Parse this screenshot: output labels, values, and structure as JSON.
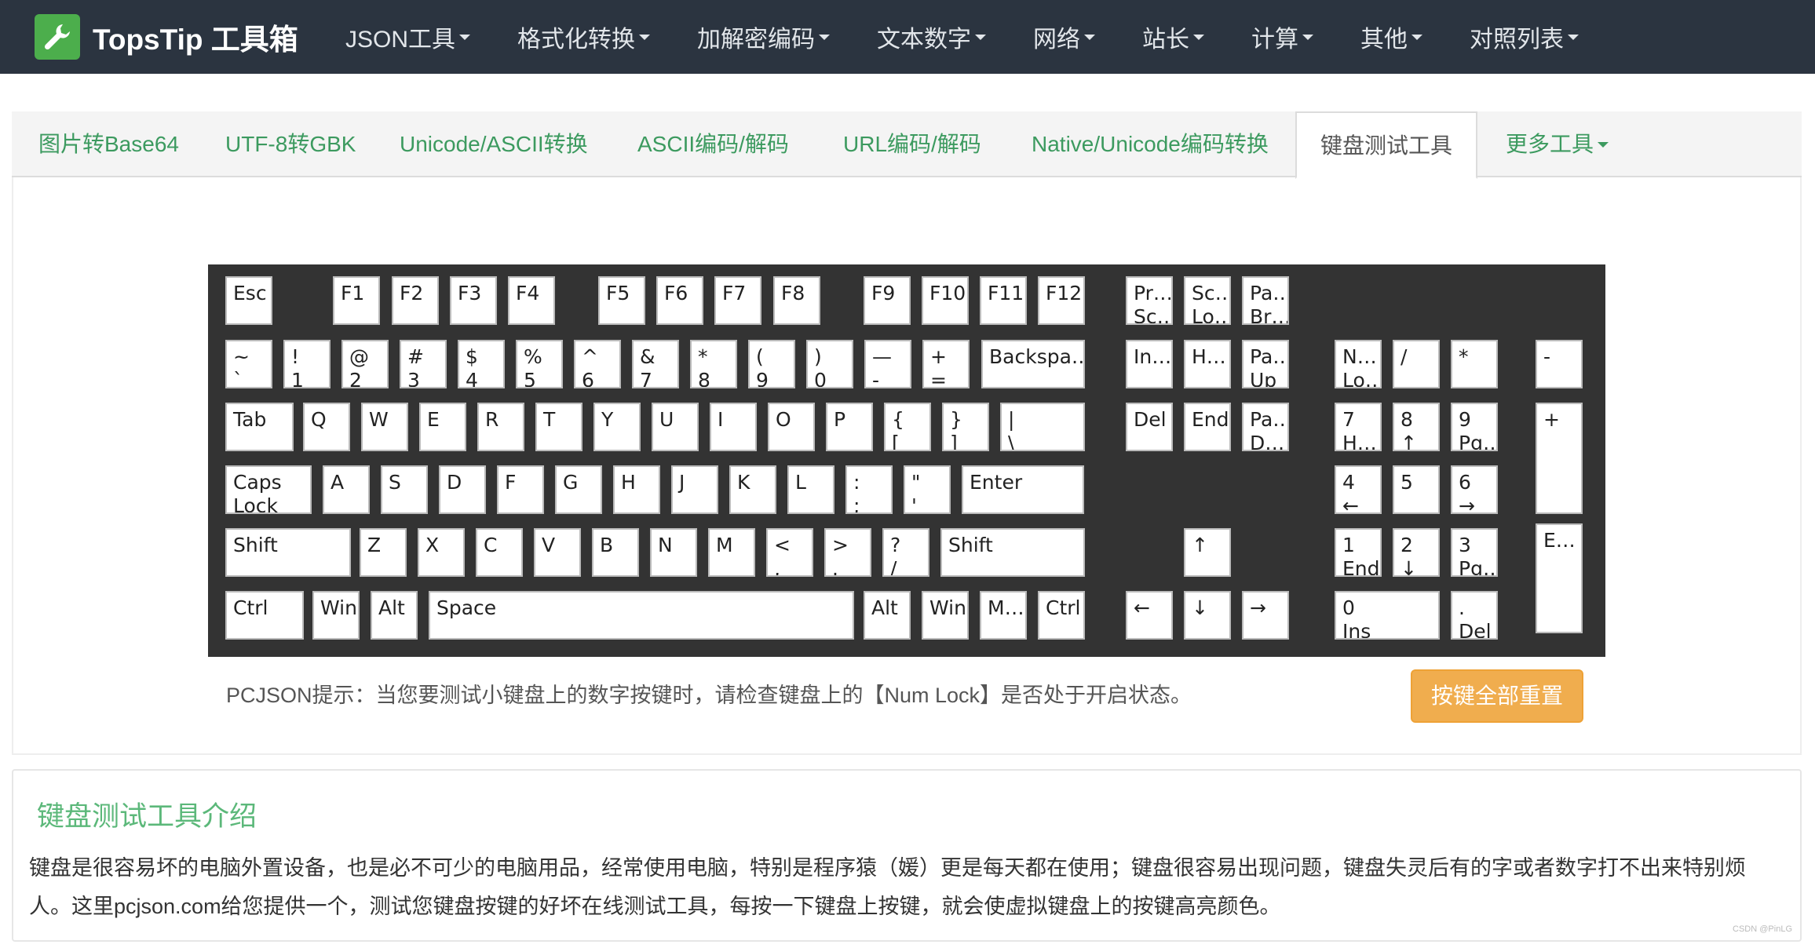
{
  "navbar": {
    "brand": "TopsTip 工具箱",
    "brand_icon": "wrench-icon",
    "items": [
      "JSON工具",
      "格式化转换",
      "加解密编码",
      "文本数字",
      "网络",
      "站长",
      "计算",
      "其他",
      "对照列表"
    ]
  },
  "tabs": [
    "图片转Base64",
    "UTF-8转GBK",
    "Unicode/ASCII转换",
    "ASCII编码/解码",
    "URL编码/解码",
    "Native/Unicode编码转换",
    "键盘测试工具",
    "更多工具"
  ],
  "active_tab": "键盘测试工具",
  "keyboard": {
    "keys": [
      "Esc",
      "F1",
      "F2",
      "F3",
      "F4",
      "F5",
      "F6",
      "F7",
      "F8",
      "F9",
      "F10",
      "F11",
      "F12",
      "Pr…\nSc…",
      "Sc…\nLo…",
      "Pa…\nBr…",
      "~\n`",
      "!\n1",
      "@\n2",
      "#\n3",
      "$\n4",
      "%\n5",
      "^\n6",
      "&\n7",
      "*\n8",
      "(\n9",
      ")\n0",
      "—\n-",
      "+\n=",
      "Backspa…",
      "In…",
      "H…",
      "Pa…\nUp",
      "N…\nLo…",
      "/",
      "*",
      "-",
      "Tab",
      "Q",
      "W",
      "E",
      "R",
      "T",
      "Y",
      "U",
      "I",
      "O",
      "P",
      "{\n[",
      "}\n]",
      "|\n\\",
      "Del",
      "End",
      "Pa…\nD…",
      "7\nH…",
      "8\n↑",
      "9\nPg…",
      "+",
      "Caps\nLock",
      "A",
      "S",
      "D",
      "F",
      "G",
      "H",
      "J",
      "K",
      "L",
      ":\n;",
      "\"\n'",
      "Enter",
      "4\n←",
      "5",
      "6\n→",
      "Shift",
      "Z",
      "X",
      "C",
      "V",
      "B",
      "N",
      "M",
      "<\n,",
      ">\n.",
      "?\n/",
      "Shift",
      "↑",
      "1\nEnd",
      "2\n↓",
      "3\nPg…",
      "E…",
      "Ctrl",
      "Win",
      "Alt",
      "Space",
      "Alt",
      "Win",
      "M…",
      "Ctrl",
      "←",
      "↓",
      "→",
      "0\nIns",
      ".\nDel"
    ]
  },
  "hint": "PCJSON提示：当您要测试小键盘上的数字按键时，请检查键盘上的【Num Lock】是否处于开启状态。",
  "reset_button": "按键全部重置",
  "intro": {
    "title": "键盘测试工具介绍",
    "body": "键盘是很容易坏的电脑外置设备，也是必不可少的电脑用品，经常使用电脑，特别是程序猿（媛）更是每天都在使用；键盘很容易出现问题，键盘失灵后有的字或者数字打不出来特别烦人。这里pcjson.com给您提供一个，测试您键盘按键的好坏在线测试工具，每按一下键盘上按键，就会使虚拟键盘上的按键高亮颜色。"
  },
  "watermark": "CSDN @PinLG"
}
